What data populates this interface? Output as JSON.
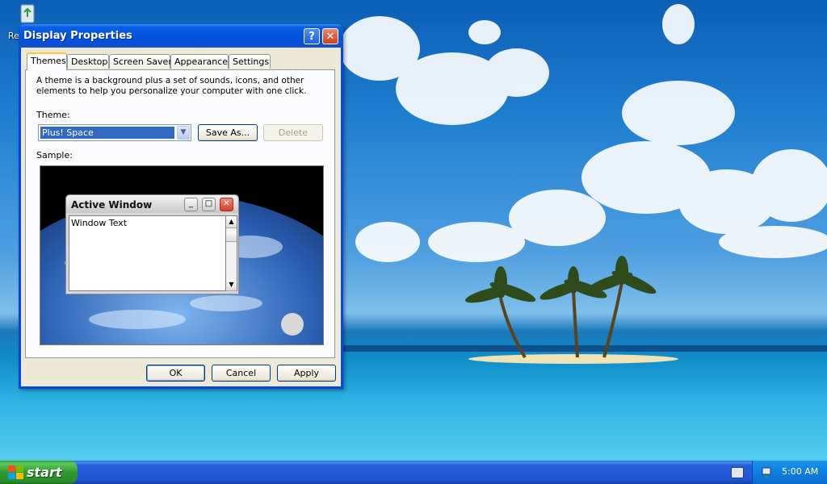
{
  "desktop": {
    "recycle_bin_label": "Re"
  },
  "window": {
    "title": "Display Properties",
    "help_icon": "help-icon",
    "close_icon": "close-icon",
    "tabs": [
      {
        "label": "Themes",
        "active": true
      },
      {
        "label": "Desktop",
        "active": false
      },
      {
        "label": "Screen Saver",
        "active": false
      },
      {
        "label": "Appearance",
        "active": false
      },
      {
        "label": "Settings",
        "active": false
      }
    ],
    "description": "A theme is a background plus a set of sounds, icons, and other elements to help you personalize your computer with one click.",
    "theme_label": "Theme:",
    "theme_value": "Plus! Space",
    "save_as_label": "Save As...",
    "delete_label": "Delete",
    "sample_label": "Sample:",
    "sample": {
      "window_title": "Active Window",
      "window_text": "Window Text"
    },
    "buttons": {
      "ok": "OK",
      "cancel": "Cancel",
      "apply": "Apply"
    }
  },
  "taskbar": {
    "start_label": "start",
    "clock": "5:00 AM",
    "tray_icons": [
      "keyboard-icon",
      "network-icon"
    ]
  },
  "colors": {
    "titlebar_blue": "#0453dd",
    "selection_blue": "#316ac5",
    "start_green": "#2f9b2f",
    "window_face": "#ece9d8"
  }
}
